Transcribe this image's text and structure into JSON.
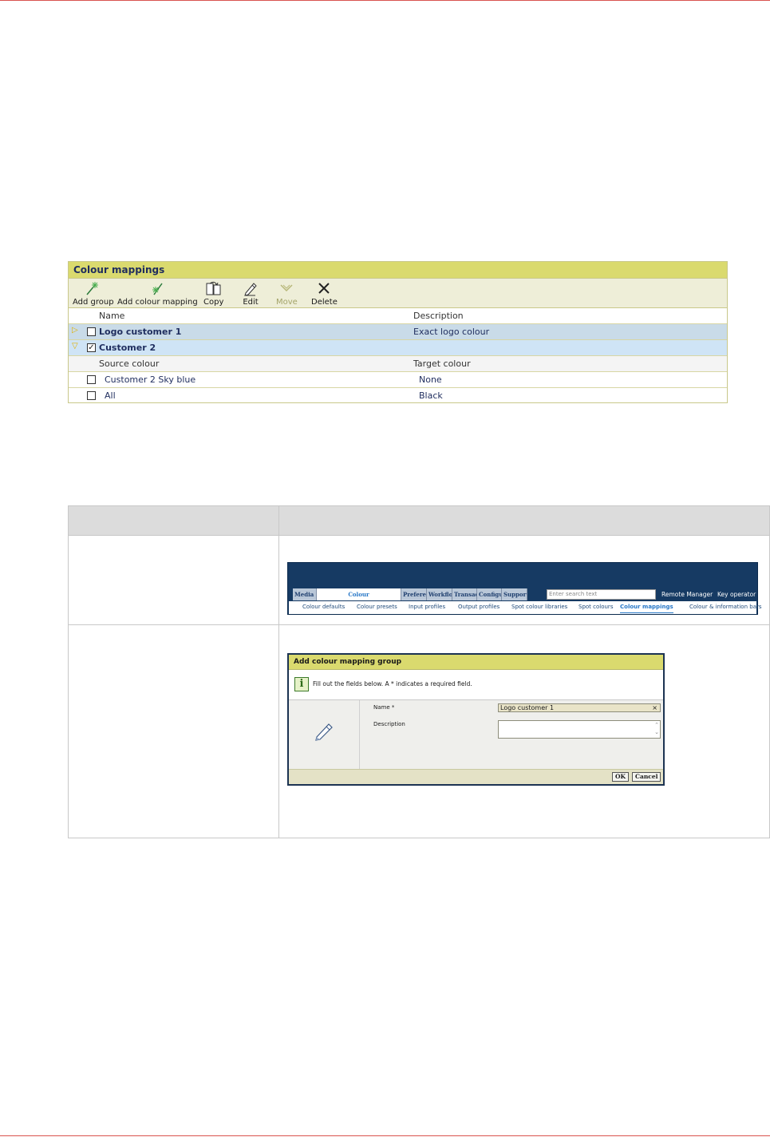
{
  "colour_mappings": {
    "title": "Colour mappings",
    "toolbar": {
      "add_group": "Add group",
      "add_colour_mapping": "Add colour mapping",
      "copy": "Copy",
      "edit": "Edit",
      "move": "Move",
      "delete": "Delete"
    },
    "columns": {
      "name": "Name",
      "description": "Description"
    },
    "groups": [
      {
        "name": "Logo customer 1",
        "description": "Exact logo colour",
        "checked": false,
        "expanded": false
      },
      {
        "name": "Customer 2",
        "description": "",
        "checked": true,
        "expanded": true
      }
    ],
    "sub_columns": {
      "source": "Source colour",
      "target": "Target colour"
    },
    "mappings": [
      {
        "source": "Customer 2 Sky blue",
        "target": "None"
      },
      {
        "source": "All",
        "target": "Black"
      }
    ]
  },
  "nav_screenshot": {
    "tabs": [
      "Media",
      "Colour",
      "Preferen",
      "Workflo",
      "Transac",
      "Configu",
      "Support"
    ],
    "active_tab": "Colour",
    "search_placeholder": "Enter search text",
    "links": [
      "Remote Manager",
      "Key operator"
    ],
    "subtabs": [
      "Colour defaults",
      "Colour presets",
      "Input profiles",
      "Output profiles",
      "Spot colour libraries",
      "Spot colours",
      "Colour mappings",
      "Colour & information bars"
    ],
    "active_subtab": "Colour mappings"
  },
  "dialog": {
    "title": "Add colour mapping group",
    "info": "Fill out the fields below. A * indicates a required field.",
    "name_label": "Name *",
    "name_value": "Logo customer 1",
    "clear": "×",
    "description_label": "Description",
    "ok": "OK",
    "cancel": "Cancel",
    "colors": {
      "title_bar": "#dada6e",
      "info_icon": "#3d7a2a"
    }
  },
  "colors": {
    "panel_header": "#dada6e",
    "group_row": "#c9dbe8",
    "nav_bg": "#163a63",
    "rule": "#d9534f"
  }
}
